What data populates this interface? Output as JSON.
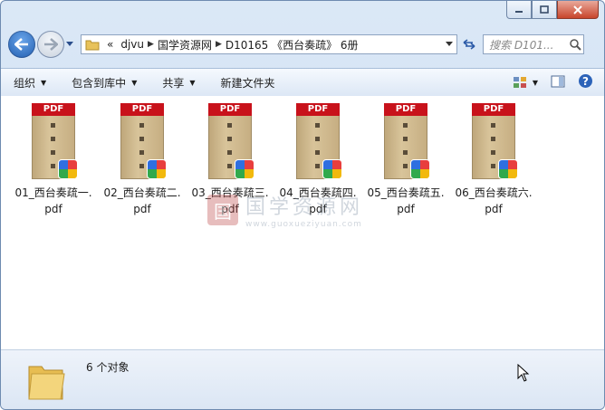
{
  "window": {
    "caption_buttons": [
      "minimize",
      "maximize",
      "close"
    ]
  },
  "nav": {
    "address": [
      "«",
      "djvu",
      "国学资源网",
      "D10165 《西台奏疏》 6册"
    ],
    "search_placeholder": "搜索 D101..."
  },
  "toolbar": {
    "organize": "组织",
    "include_in_library": "包含到库中",
    "share": "共享",
    "new_folder": "新建文件夹"
  },
  "files": [
    {
      "line1": "01_西台奏疏一.",
      "line2": "pdf"
    },
    {
      "line1": "02_西台奏疏二.",
      "line2": "pdf"
    },
    {
      "line1": "03_西台奏疏三.",
      "line2": "pdf"
    },
    {
      "line1": "04_西台奏疏四.",
      "line2": "pdf"
    },
    {
      "line1": "05_西台奏疏五.",
      "line2": "pdf"
    },
    {
      "line1": "06_西台奏疏六.",
      "line2": "pdf"
    }
  ],
  "file_badge": "PDF",
  "watermark": {
    "title": "国学资源网",
    "url": "www.guoxueziyuan.com",
    "logo": "国"
  },
  "status": {
    "count": "6 个对象"
  },
  "colors": {
    "pdf_red": "#c8121b",
    "window_frame": "#c9dcf2",
    "close": "#c8452c"
  }
}
